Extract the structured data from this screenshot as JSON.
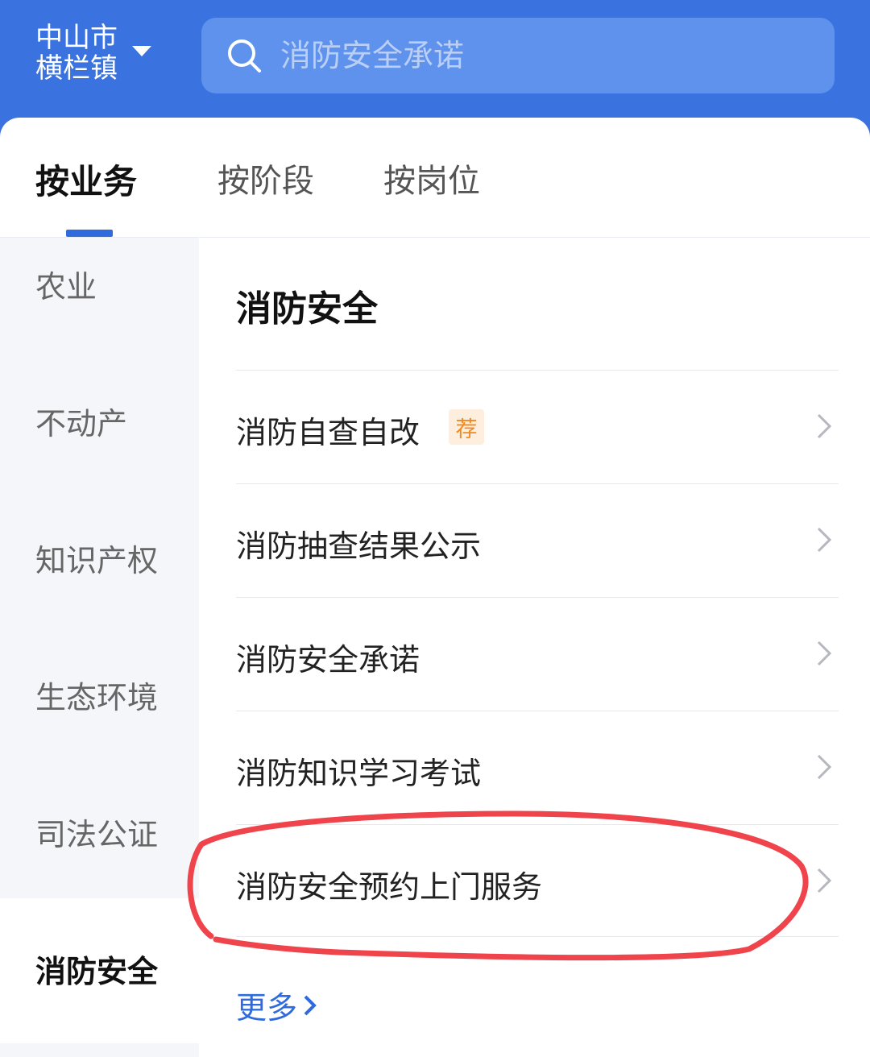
{
  "header": {
    "location_city": "中山市",
    "location_town": "横栏镇",
    "search_placeholder": "消防安全承诺"
  },
  "tabs": [
    {
      "label": "按业务",
      "active": true
    },
    {
      "label": "按阶段",
      "active": false
    },
    {
      "label": "按岗位",
      "active": false
    }
  ],
  "sidebar": {
    "items": [
      {
        "label": "农业",
        "active": false
      },
      {
        "label": "不动产",
        "active": false
      },
      {
        "label": "知识产权",
        "active": false
      },
      {
        "label": "生态环境",
        "active": false
      },
      {
        "label": "司法公证",
        "active": false
      },
      {
        "label": "消防安全",
        "active": true
      }
    ]
  },
  "content": {
    "section_title": "消防安全",
    "items": [
      {
        "label": "消防自查自改",
        "badge": "荐"
      },
      {
        "label": "消防抽查结果公示"
      },
      {
        "label": "消防安全承诺"
      },
      {
        "label": "消防知识学习考试"
      },
      {
        "label": "消防安全预约上门服务"
      }
    ],
    "more_label": "更多"
  },
  "colors": {
    "brand_blue": "#3a73e0",
    "search_bg": "#5f92ec",
    "accent_blue": "#2f6bdc",
    "badge_orange": "#f08a24",
    "annotation_red": "#f0444c"
  }
}
